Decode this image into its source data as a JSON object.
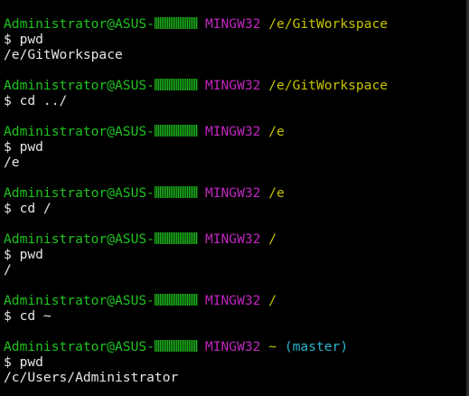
{
  "colors": {
    "background": "#000000",
    "user": "#1fc21f",
    "system": "#c026c0",
    "path": "#c7c400",
    "branch": "#2bb3c9",
    "text": "#e6e6e6"
  },
  "session": [
    {
      "prompt": {
        "user": "Administrator@ASUS-",
        "system": "MINGW32",
        "path": "/e/GitWorkspace",
        "branch": ""
      },
      "command": "$ pwd",
      "output": "/e/GitWorkspace"
    },
    {
      "prompt": {
        "user": "Administrator@ASUS-",
        "system": "MINGW32",
        "path": "/e/GitWorkspace",
        "branch": ""
      },
      "command": "$ cd ../",
      "output": ""
    },
    {
      "prompt": {
        "user": "Administrator@ASUS-",
        "system": "MINGW32",
        "path": "/e",
        "branch": ""
      },
      "command": "$ pwd",
      "output": "/e"
    },
    {
      "prompt": {
        "user": "Administrator@ASUS-",
        "system": "MINGW32",
        "path": "/e",
        "branch": ""
      },
      "command": "$ cd /",
      "output": ""
    },
    {
      "prompt": {
        "user": "Administrator@ASUS-",
        "system": "MINGW32",
        "path": "/",
        "branch": ""
      },
      "command": "$ pwd",
      "output": "/"
    },
    {
      "prompt": {
        "user": "Administrator@ASUS-",
        "system": "MINGW32",
        "path": "/",
        "branch": ""
      },
      "command": "$ cd ~",
      "output": ""
    },
    {
      "prompt": {
        "user": "Administrator@ASUS-",
        "system": "MINGW32",
        "path": "~",
        "branch": "(master)"
      },
      "command": "$ pwd",
      "output": "/c/Users/Administrator"
    }
  ]
}
